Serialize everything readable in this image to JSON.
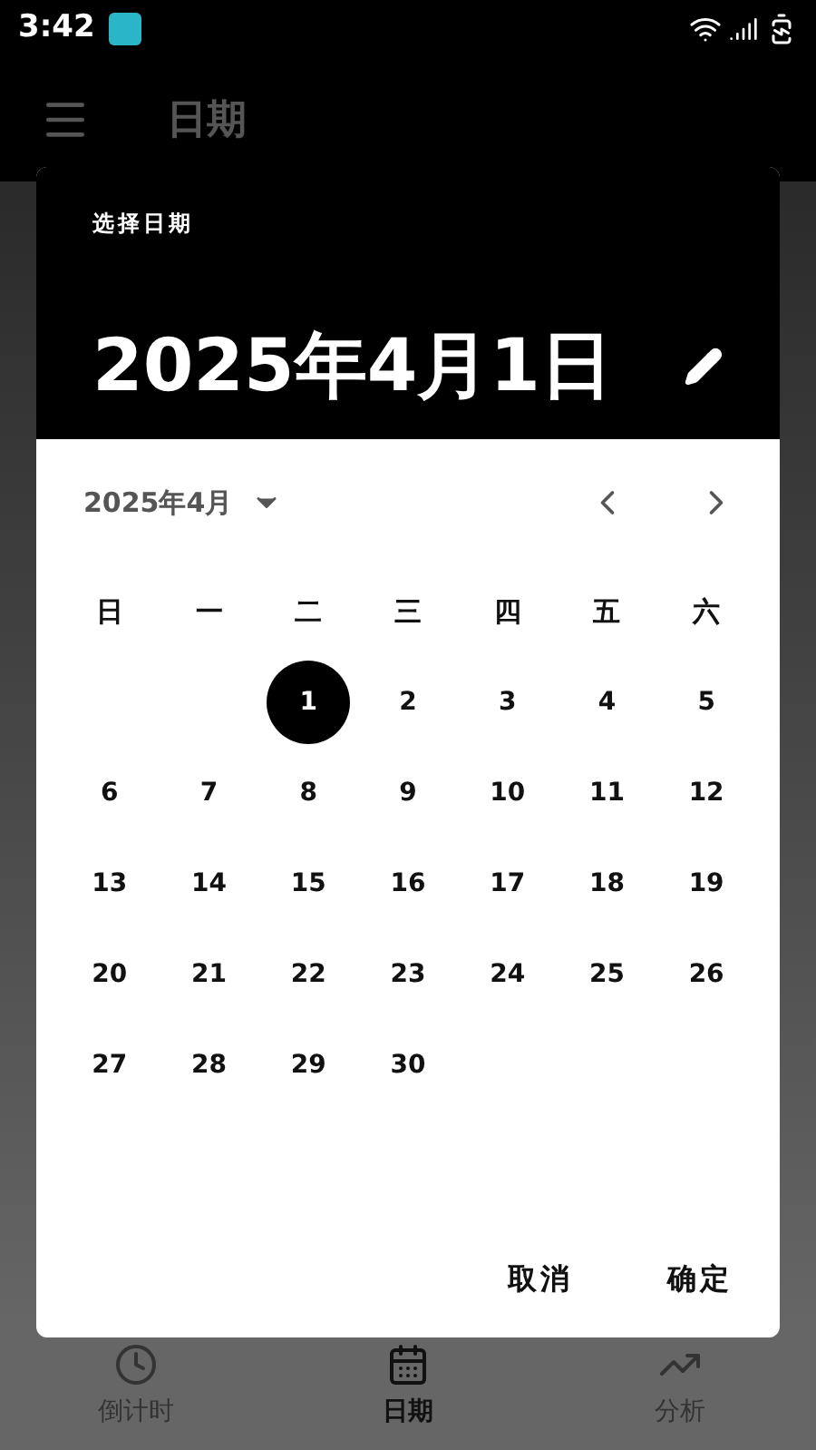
{
  "status_bar": {
    "time": "3:42"
  },
  "app_bar": {
    "title": "日期"
  },
  "dialog": {
    "label": "选择日期",
    "headline": "2025年4月1日",
    "month_label": "2025年4月",
    "weekdays": [
      "日",
      "一",
      "二",
      "三",
      "四",
      "五",
      "六"
    ],
    "weeks": [
      [
        {
          "kind": "blank"
        },
        {
          "kind": "blank"
        },
        {
          "kind": "day",
          "day": "1",
          "selected": true
        },
        {
          "kind": "day",
          "day": "2",
          "selected": false
        },
        {
          "kind": "day",
          "day": "3",
          "selected": false
        },
        {
          "kind": "day",
          "day": "4",
          "selected": false
        },
        {
          "kind": "day",
          "day": "5",
          "selected": false
        }
      ],
      [
        {
          "day": "6",
          "selected": false
        },
        {
          "day": "7",
          "selected": false
        },
        {
          "day": "8",
          "selected": false
        },
        {
          "day": "9",
          "selected": false
        },
        {
          "day": "10",
          "selected": false
        },
        {
          "day": "11",
          "selected": false
        },
        {
          "day": "12",
          "selected": false
        }
      ],
      [
        {
          "day": "13",
          "selected": false
        },
        {
          "day": "14",
          "selected": false
        },
        {
          "day": "15",
          "selected": false
        },
        {
          "day": "16",
          "selected": false
        },
        {
          "day": "17",
          "selected": false
        },
        {
          "day": "18",
          "selected": false
        },
        {
          "day": "19",
          "selected": false
        }
      ],
      [
        {
          "day": "20",
          "selected": false
        },
        {
          "day": "21",
          "selected": false
        },
        {
          "day": "22",
          "selected": false
        },
        {
          "day": "23",
          "selected": false
        },
        {
          "day": "24",
          "selected": false
        },
        {
          "day": "25",
          "selected": false
        },
        {
          "day": "26",
          "selected": false
        }
      ],
      [
        {
          "day": "27",
          "selected": false
        },
        {
          "day": "28",
          "selected": false
        },
        {
          "day": "29",
          "selected": false
        },
        {
          "day": "30",
          "selected": false
        }
      ]
    ],
    "buttons": [
      "取消",
      "确定"
    ]
  },
  "bottom_nav": [
    {
      "label": "倒计时",
      "kind": "clock",
      "selected": false
    },
    {
      "label": "日期",
      "kind": "calendar",
      "selected": true
    },
    {
      "label": "分析",
      "kind": "chart",
      "selected": false
    }
  ]
}
